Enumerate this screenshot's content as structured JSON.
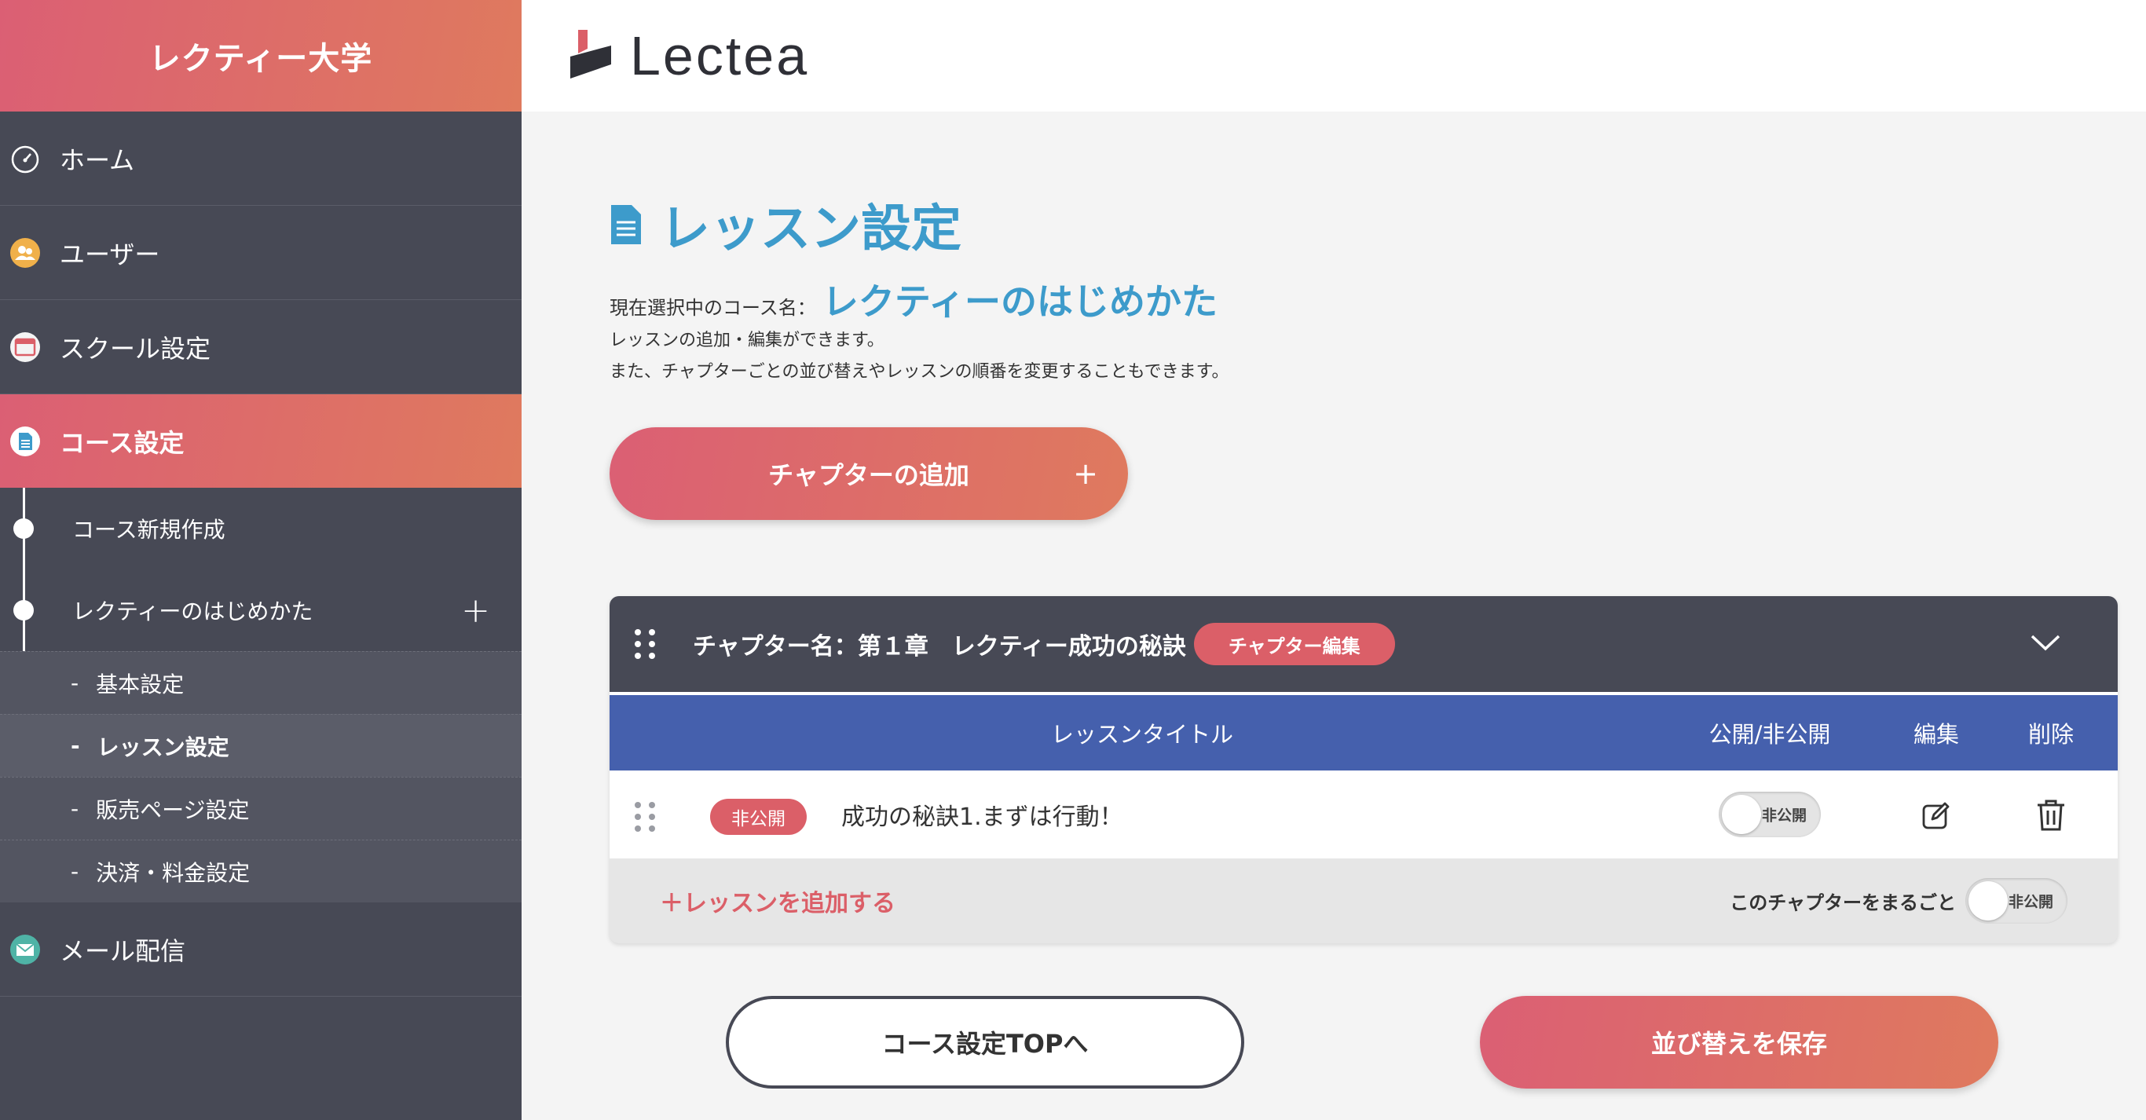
{
  "sidebar": {
    "brand": "レクティー大学",
    "items": [
      {
        "label": "ホーム",
        "icon": "dashboard-icon"
      },
      {
        "label": "ユーザー",
        "icon": "users-icon"
      },
      {
        "label": "スクール設定",
        "icon": "window-icon"
      },
      {
        "label": "コース設定",
        "icon": "document-icon"
      },
      {
        "label": "メール配信",
        "icon": "mail-icon"
      }
    ],
    "sub_items": [
      {
        "label": "コース新規作成"
      },
      {
        "label": "レクティーのはじめかた",
        "action": "+"
      }
    ],
    "subsub_items": [
      {
        "dash": "-",
        "label": "基本設定"
      },
      {
        "dash": "-",
        "label": "レッスン設定"
      },
      {
        "dash": "-",
        "label": "販売ページ設定"
      },
      {
        "dash": "-",
        "label": "決済・料金設定"
      }
    ]
  },
  "header": {
    "logo_text": "Lectea"
  },
  "main": {
    "title": "レッスン設定",
    "course_label": "現在選択中のコース名：",
    "course_name": "レクティーのはじめかた",
    "desc_line1": "レッスンの追加・編集ができます。",
    "desc_line2": "また、チャプターごとの並び替えやレッスンの順番を変更することもできます。",
    "add_chapter_label": "チャプターの追加",
    "add_chapter_plus": "+"
  },
  "chapter": {
    "title": "チャプター名：第１章　レクティー成功の秘訣",
    "edit_label": "チャプター編集",
    "columns": {
      "title": "レッスンタイトル",
      "visibility": "公開/非公開",
      "edit": "編集",
      "delete": "削除"
    },
    "lessons": [
      {
        "status": "非公開",
        "title": "成功の秘訣1.まずは行動！",
        "toggle_label": "非公開"
      }
    ],
    "add_lesson_label": "＋レッスンを追加する",
    "whole_chapter_label": "このチャプターをまるごと",
    "whole_toggle_label": "非公開"
  },
  "footer_buttons": {
    "course_top": "コース設定TOPへ",
    "save_order": "並び替えを保存"
  },
  "colors": {
    "accent_gradient_start": "#db5f74",
    "accent_gradient_end": "#df7a5e",
    "sidebar_bg": "#474955",
    "title_blue": "#3d9bcb",
    "table_header_blue": "#4560ad",
    "badge_red": "#db5f68"
  }
}
